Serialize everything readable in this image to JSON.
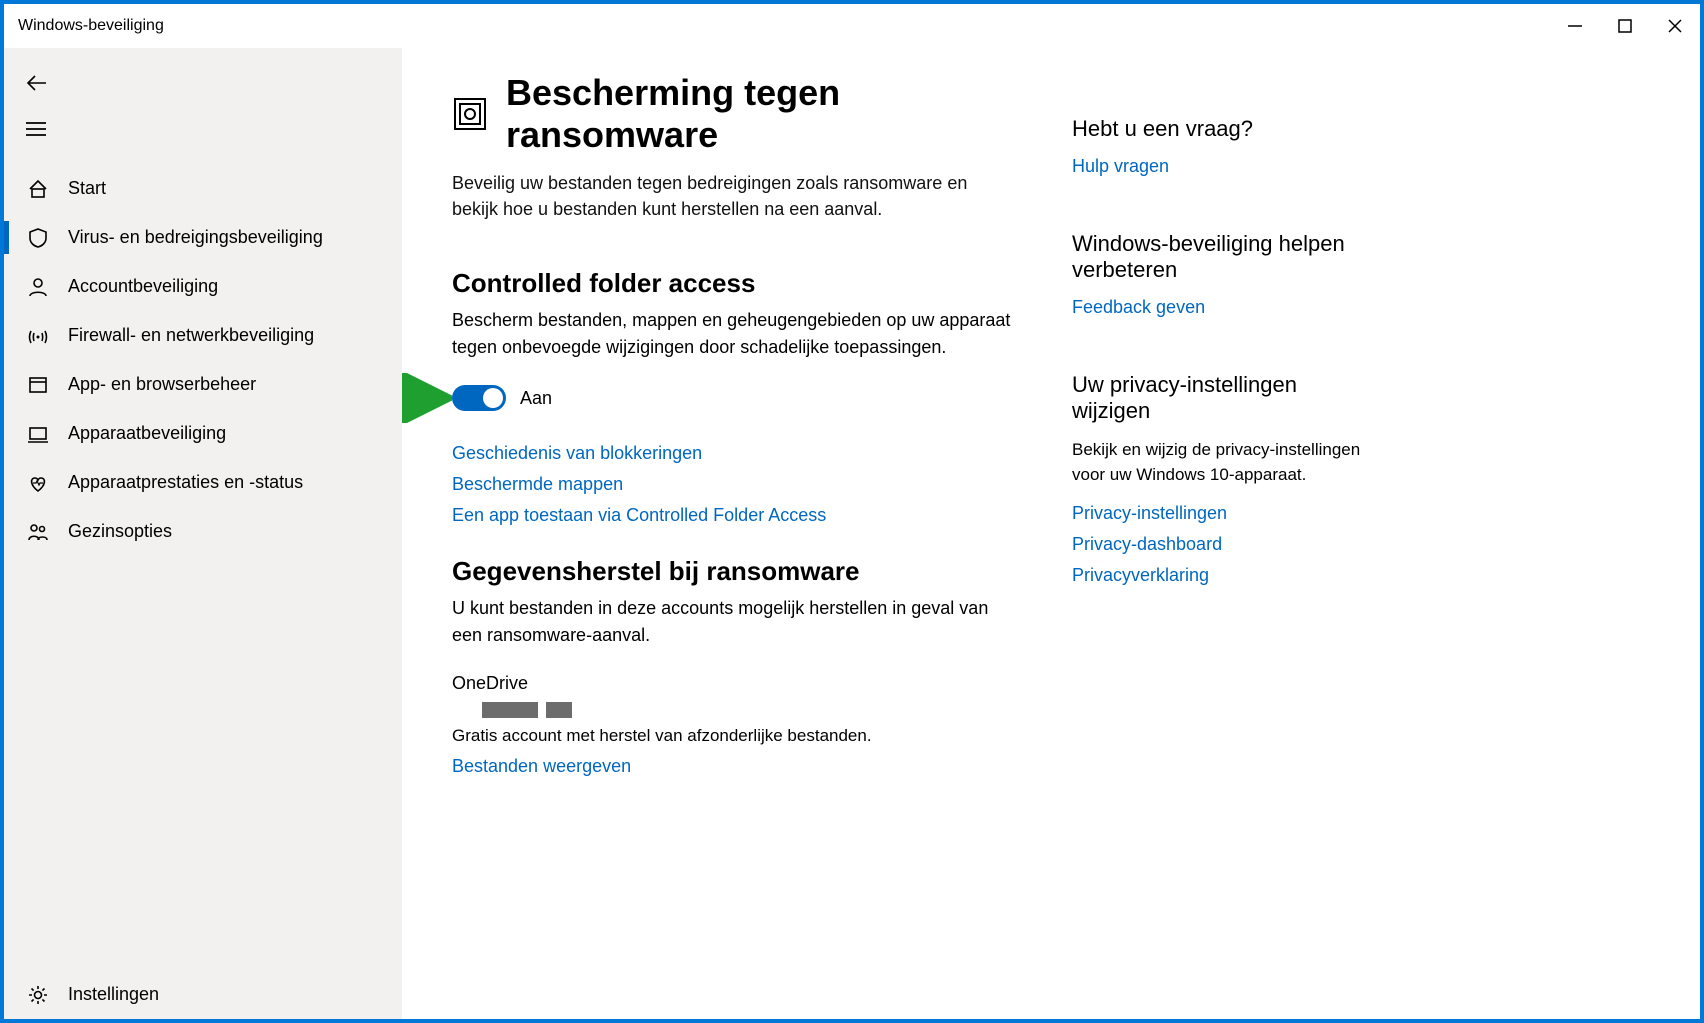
{
  "window": {
    "title": "Windows-beveiliging"
  },
  "sidebar": {
    "items": [
      {
        "label": "Start"
      },
      {
        "label": "Virus- en bedreigingsbeveiliging"
      },
      {
        "label": "Accountbeveiliging"
      },
      {
        "label": "Firewall- en netwerkbeveiliging"
      },
      {
        "label": "App- en browserbeheer"
      },
      {
        "label": "Apparaatbeveiliging"
      },
      {
        "label": "Apparaatprestaties en -status"
      },
      {
        "label": "Gezinsopties"
      }
    ],
    "settings": "Instellingen"
  },
  "main": {
    "title": "Bescherming tegen ransomware",
    "description": "Beveilig uw bestanden tegen bedreigingen zoals ransomware en bekijk hoe u bestanden kunt herstellen na een aanval.",
    "cfa": {
      "heading": "Controlled folder access",
      "description": "Bescherm bestanden, mappen en geheugengebieden op uw apparaat tegen onbevoegde wijzigingen door schadelijke toepassingen.",
      "toggle_state": "Aan",
      "links": {
        "history": "Geschiedenis van blokkeringen",
        "protected": "Beschermde mappen",
        "allow_app": "Een app toestaan via Controlled Folder Access"
      }
    },
    "recovery": {
      "heading": "Gegevensherstel bij ransomware",
      "description": "U kunt bestanden in deze accounts mogelijk herstellen in geval van een ransomware-aanval.",
      "onedrive_label": "OneDrive",
      "onedrive_desc": "Gratis account met herstel van afzonderlijke bestanden.",
      "view_files": "Bestanden weergeven"
    }
  },
  "aside": {
    "question": {
      "heading": "Hebt u een vraag?",
      "link": "Hulp vragen"
    },
    "improve": {
      "heading": "Windows-beveiliging helpen verbeteren",
      "link": "Feedback geven"
    },
    "privacy": {
      "heading": "Uw privacy-instellingen wijzigen",
      "description": "Bekijk en wijzig de privacy-instellingen voor uw Windows 10-apparaat.",
      "links": {
        "settings": "Privacy-instellingen",
        "dashboard": "Privacy-dashboard",
        "statement": "Privacyverklaring"
      }
    }
  }
}
